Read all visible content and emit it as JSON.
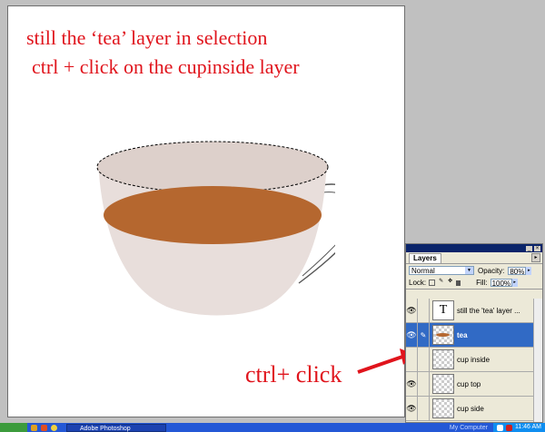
{
  "instructions": {
    "line1": "still the ‘tea’ layer in selection",
    "line2": "ctrl + click on the cupinside layer",
    "callout": "ctrl+ click"
  },
  "colors": {
    "annotation": "#e0141c",
    "tea": "#b5672f",
    "cup": "#e8dedb",
    "selected_row": "#316ac5"
  },
  "layers_panel": {
    "tab_label": "Layers",
    "blend_mode": "Normal",
    "opacity_label": "Opacity:",
    "opacity_value": "80%",
    "lock_label": "Lock:",
    "fill_label": "Fill:",
    "fill_value": "100%",
    "layers": [
      {
        "name": "still the 'tea' layer ...",
        "type": "text",
        "visible": true,
        "selected": false,
        "thumb_glyph": "T"
      },
      {
        "name": "tea",
        "type": "pixel",
        "visible": true,
        "selected": true
      },
      {
        "name": "cup inside",
        "type": "pixel",
        "visible": false,
        "selected": false
      },
      {
        "name": "cup top",
        "type": "pixel",
        "visible": true,
        "selected": false
      },
      {
        "name": "cup side",
        "type": "pixel",
        "visible": true,
        "selected": false
      }
    ]
  },
  "taskbar": {
    "app_button": "Adobe Photoshop",
    "tray_text": "My Computer",
    "clock": "11:46 AM"
  }
}
